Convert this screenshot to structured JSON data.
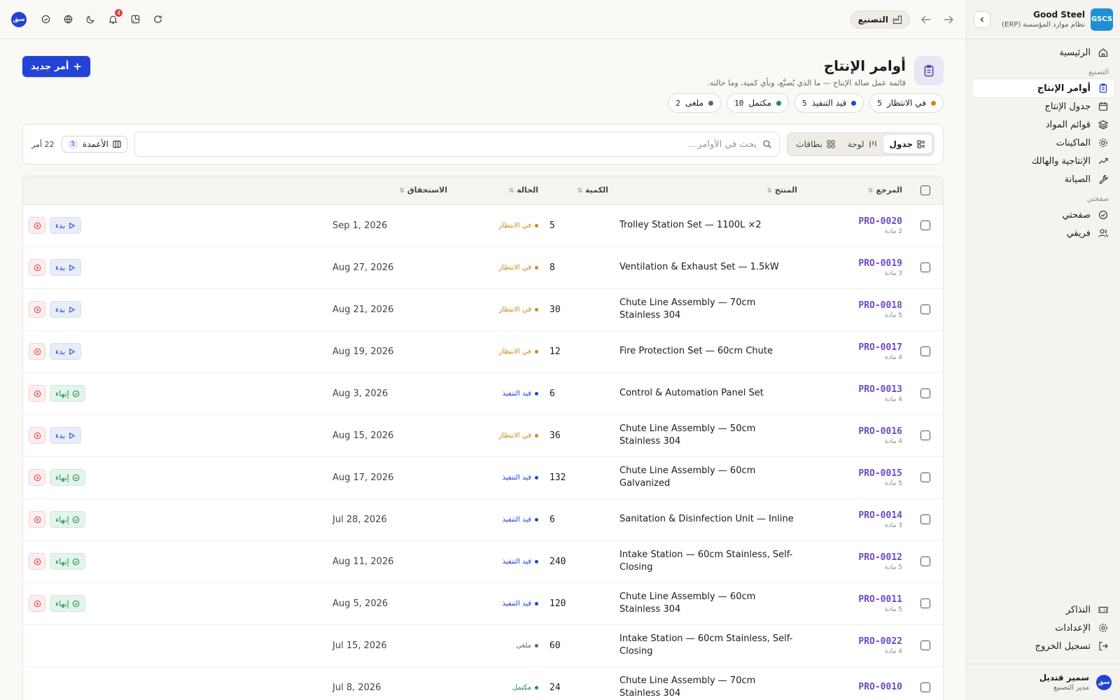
{
  "brand": {
    "name": "Good Steel",
    "subtitle": "نظام موارد المؤسسة (ERP)",
    "logo": "GSCS"
  },
  "topbar": {
    "module": "التصنيع",
    "user_initials": "سق",
    "notifications_count": "4",
    "icons": [
      "refresh-icon",
      "apps-icon",
      "bell-icon",
      "moon-icon",
      "globe-icon",
      "check-circle-icon"
    ]
  },
  "sidebar": {
    "home": "الرئيسية",
    "section_manufacturing": "التصنيع",
    "items": [
      {
        "label": "أوامر الإنتاج",
        "icon": "clipboard-icon",
        "active": true
      },
      {
        "label": "جدول الإنتاج",
        "icon": "calendar-icon",
        "active": false
      },
      {
        "label": "قوائم المواد",
        "icon": "layers-icon",
        "active": false
      },
      {
        "label": "الماكينات",
        "icon": "cog-icon",
        "active": false
      },
      {
        "label": "الإنتاجية والهالك",
        "icon": "trend-icon",
        "active": false
      },
      {
        "label": "الصيانة",
        "icon": "wrench-icon",
        "active": false
      }
    ],
    "section_mypage": "صفحتي",
    "my_items": [
      {
        "label": "صفحتي",
        "icon": "check-circle-icon"
      },
      {
        "label": "فريقي",
        "icon": "users-icon"
      }
    ],
    "bottom_items": [
      {
        "label": "التذاكر",
        "icon": "ticket-icon"
      },
      {
        "label": "الإعدادات",
        "icon": "settings-icon"
      },
      {
        "label": "تسجيل الخروج",
        "icon": "logout-icon"
      }
    ],
    "user": {
      "name": "سمير قنديل",
      "role": "مدير التصنيع",
      "initials": "سق"
    }
  },
  "page": {
    "title": "أوامر الإنتاج",
    "subtitle": "قائمة عمل صالة الإنتاج — ما الذي يُصنَّع، وبأي كمية، وما حالته.",
    "new_button": "أمر جديد"
  },
  "status_pills": [
    {
      "label": "في الانتظار",
      "count": "5",
      "color": "#c98a1a"
    },
    {
      "label": "قيد التنفيذ",
      "count": "5",
      "color": "#2342d6"
    },
    {
      "label": "مكتمل",
      "count": "10",
      "color": "#1f8a4c"
    },
    {
      "label": "ملغى",
      "count": "2",
      "color": "#666666"
    }
  ],
  "toolbar": {
    "views": [
      "جدول",
      "لوحة",
      "بطاقات"
    ],
    "search_placeholder": "بحث في الأوامر...",
    "columns_label": "الأعمدة",
    "columns_count": "5",
    "orders_count": "22 أمر"
  },
  "table": {
    "headers": {
      "ref": "المرجع",
      "product": "المنتج",
      "qty": "الكمية",
      "status": "الحالة",
      "due": "الاستحقاق"
    },
    "actions": {
      "start": "بدء",
      "finish": "إنهاء"
    },
    "rows": [
      {
        "ref": "PRO-0020",
        "sub": "2 مادة",
        "product": "Trolley Station Set — 1100L ×2",
        "qty": "5",
        "status": "في الانتظار",
        "status_color": "#c98a1a",
        "due": "Sep 1, 2026",
        "action": "start"
      },
      {
        "ref": "PRO-0019",
        "sub": "3 مادة",
        "product": "Ventilation & Exhaust Set — 1.5kW",
        "qty": "8",
        "status": "في الانتظار",
        "status_color": "#c98a1a",
        "due": "Aug 27, 2026",
        "action": "start"
      },
      {
        "ref": "PRO-0018",
        "sub": "5 مادة",
        "product": "Chute Line Assembly — 70cm Stainless 304",
        "qty": "30",
        "status": "في الانتظار",
        "status_color": "#c98a1a",
        "due": "Aug 21, 2026",
        "action": "start"
      },
      {
        "ref": "PRO-0017",
        "sub": "4 مادة",
        "product": "Fire Protection Set — 60cm Chute",
        "qty": "12",
        "status": "في الانتظار",
        "status_color": "#c98a1a",
        "due": "Aug 19, 2026",
        "action": "start"
      },
      {
        "ref": "PRO-0013",
        "sub": "4 مادة",
        "product": "Control & Automation Panel Set",
        "qty": "6",
        "status": "قيد التنفيذ",
        "status_color": "#2342d6",
        "due": "Aug 3, 2026",
        "action": "finish"
      },
      {
        "ref": "PRO-0016",
        "sub": "4 مادة",
        "product": "Chute Line Assembly — 50cm Stainless 304",
        "qty": "36",
        "status": "في الانتظار",
        "status_color": "#c98a1a",
        "due": "Aug 15, 2026",
        "action": "start"
      },
      {
        "ref": "PRO-0015",
        "sub": "5 مادة",
        "product": "Chute Line Assembly — 60cm Galvanized",
        "qty": "132",
        "status": "قيد التنفيذ",
        "status_color": "#2342d6",
        "due": "Aug 17, 2026",
        "action": "finish"
      },
      {
        "ref": "PRO-0014",
        "sub": "3 مادة",
        "product": "Sanitation & Disinfection Unit — Inline",
        "qty": "6",
        "status": "قيد التنفيذ",
        "status_color": "#2342d6",
        "due": "Jul 28, 2026",
        "action": "finish"
      },
      {
        "ref": "PRO-0012",
        "sub": "5 مادة",
        "product": "Intake Station — 60cm Stainless, Self-Closing",
        "qty": "240",
        "status": "قيد التنفيذ",
        "status_color": "#2342d6",
        "due": "Aug 11, 2026",
        "action": "finish"
      },
      {
        "ref": "PRO-0011",
        "sub": "5 مادة",
        "product": "Chute Line Assembly — 60cm Stainless 304",
        "qty": "120",
        "status": "قيد التنفيذ",
        "status_color": "#2342d6",
        "due": "Aug 5, 2026",
        "action": "finish"
      },
      {
        "ref": "PRO-0022",
        "sub": "4 مادة",
        "product": "Intake Station — 60cm Stainless, Self-Closing",
        "qty": "60",
        "status": "ملغى",
        "status_color": "#666666",
        "due": "Jul 15, 2026",
        "action": "none"
      },
      {
        "ref": "PRO-0010",
        "sub": "",
        "product": "Chute Line Assembly — 70cm Stainless 304",
        "qty": "24",
        "status": "مكتمل",
        "status_color": "#1f8a4c",
        "due": "Jul 8, 2026",
        "action": "none"
      }
    ]
  }
}
